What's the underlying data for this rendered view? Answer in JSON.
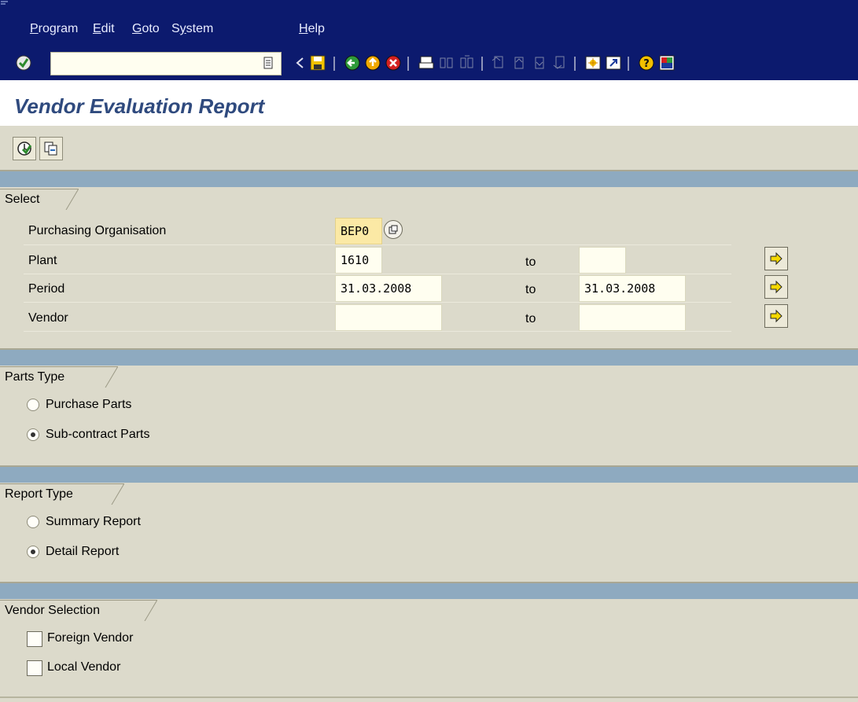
{
  "menu": {
    "items": [
      {
        "mnemonic": "P",
        "rest": "rogram"
      },
      {
        "mnemonic": "E",
        "rest": "dit"
      },
      {
        "mnemonic": "G",
        "rest": "oto"
      },
      {
        "pre": "S",
        "mnemonic": "y",
        "rest": "stem"
      },
      {
        "mnemonic": "H",
        "rest": "elp"
      }
    ]
  },
  "toolbar": {
    "command_value": "",
    "icons": [
      "enter-icon",
      "back-icon",
      "save-icon",
      "back-nav-icon",
      "exit-icon",
      "cancel-icon",
      "print-icon",
      "find-icon",
      "find-next-icon",
      "first-page-icon",
      "previous-page-icon",
      "next-page-icon",
      "last-page-icon",
      "new-session-icon",
      "shortcut-icon",
      "help-icon",
      "layout-icon"
    ]
  },
  "title": "Vendor Evaluation Report",
  "sections": {
    "select": {
      "label": "Select",
      "rows": {
        "purch_org": {
          "label": "Purchasing Organisation",
          "from": "BEP0"
        },
        "plant": {
          "label": "Plant",
          "from": "1610",
          "to_label": "to",
          "to": ""
        },
        "period": {
          "label": "Period",
          "from": "31.03.2008",
          "to_label": "to",
          "to": "31.03.2008"
        },
        "vendor": {
          "label": "Vendor",
          "from": "",
          "to_label": "to",
          "to": ""
        }
      }
    },
    "parts_type": {
      "label": "Parts Type",
      "options": {
        "purchase": {
          "label": "Purchase Parts",
          "selected": false
        },
        "subcontract": {
          "label": "Sub-contract Parts",
          "selected": true
        }
      }
    },
    "report_type": {
      "label": "Report Type",
      "options": {
        "summary": {
          "label": "Summary Report",
          "selected": false
        },
        "detail": {
          "label": "Detail Report",
          "selected": true
        }
      }
    },
    "vendor_selection": {
      "label": "Vendor Selection",
      "options": {
        "foreign": {
          "label": "Foreign Vendor",
          "checked": false
        },
        "local": {
          "label": "Local Vendor",
          "checked": false
        }
      }
    }
  },
  "colors": {
    "menubar": "#0c1a6e",
    "title": "#2f4a7e",
    "section_bar": "#8eaac0",
    "background": "#dcdacb",
    "required_field": "#fbe9a5"
  }
}
